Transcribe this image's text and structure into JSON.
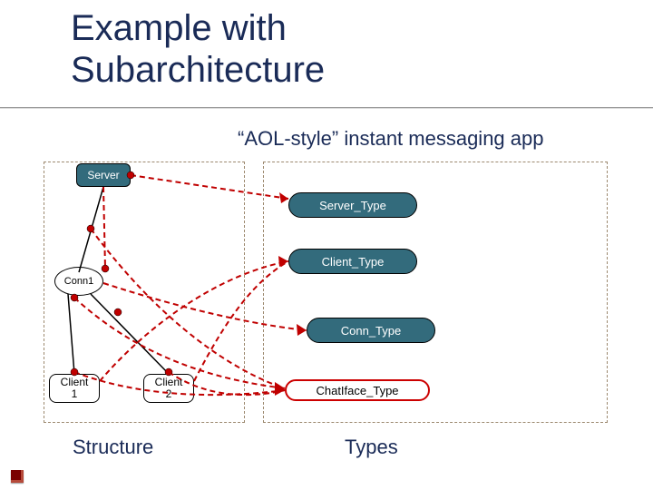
{
  "title_line1": "Example with",
  "title_line2": "Subarchitecture",
  "subtitle": "“AOL-style” instant messaging app",
  "structure": {
    "server": "Server",
    "conn1": "Conn1",
    "client1_l1": "Client",
    "client1_l2": "1",
    "client2_l1": "Client",
    "client2_l2": "2"
  },
  "types": {
    "server_type": "Server_Type",
    "client_type": "Client_Type",
    "conn_type": "Conn_Type",
    "chatiface_type": "ChatIface_Type"
  },
  "labels": {
    "structure": "Structure",
    "types": "Types"
  },
  "colors": {
    "accent_teal": "#336b7c",
    "title_navy": "#1a2b57",
    "dashed_red": "#c00000",
    "frame": "#9c896f"
  }
}
